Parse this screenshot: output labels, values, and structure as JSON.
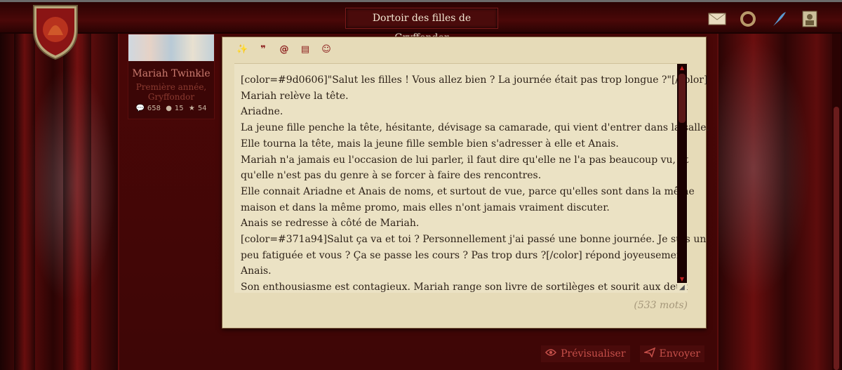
{
  "header": {
    "title": "Dortoir des filles de Gryffondor",
    "icons": [
      "crest-icon",
      "envelope-icon",
      "ring-icon",
      "quill-icon",
      "portrait-icon"
    ]
  },
  "user": {
    "name": "Mariah Twinkle",
    "rank_line1": "Première année,",
    "rank_line2": "Gryffondor",
    "stats": {
      "posts": "658",
      "coins": "15",
      "points": "54"
    }
  },
  "toolbar": {
    "magic_glyph": "✨",
    "quote_glyph": "❞",
    "mention_glyph": "@",
    "table_glyph": "▤",
    "emoji_glyph": "☺"
  },
  "editor": {
    "lines": [
      "[color=#9d0606]\"Salut les filles ! Vous allez bien ? La journée était pas trop longue ?\"[/color]",
      "Mariah relève la tête.",
      "Ariadne.",
      "La jeune fille penche la tête, hésitante, dévisage sa camarade, qui vient d'entrer dans la salle.",
      "Elle tourna la tête, mais la jeune fille semble bien s'adresser à elle et Anais.",
      "Mariah n'a jamais eu l'occasion de lui parler, il faut dire qu'elle ne l'a pas beaucoup vu, et",
      "qu'elle n'est pas du genre à se forcer à faire des rencontres.",
      "Elle connait Ariadne et Anais de noms, et surtout de vue, parce qu'elles sont dans la même",
      "maison et dans la même promo, mais elles n'ont jamais vraiment discuter.",
      "Anais se redresse à côté de Mariah.",
      "[color=#371a94]Salut ça va et toi ? Personnellement j'ai passé une bonne journée. Je suis un",
      "peu fatiguée et vous ? Ça se passe les cours ? Pas trop durs ?[/color] répond joyeusement",
      "Anais.",
      "Son enthousiasme est contagieux. Mariah range son livre de sortilèges et sourit aux deux"
    ],
    "word_count": "(533 mots)"
  },
  "actions": {
    "preview_label": "Prévisualiser",
    "send_label": "Envoyer"
  }
}
